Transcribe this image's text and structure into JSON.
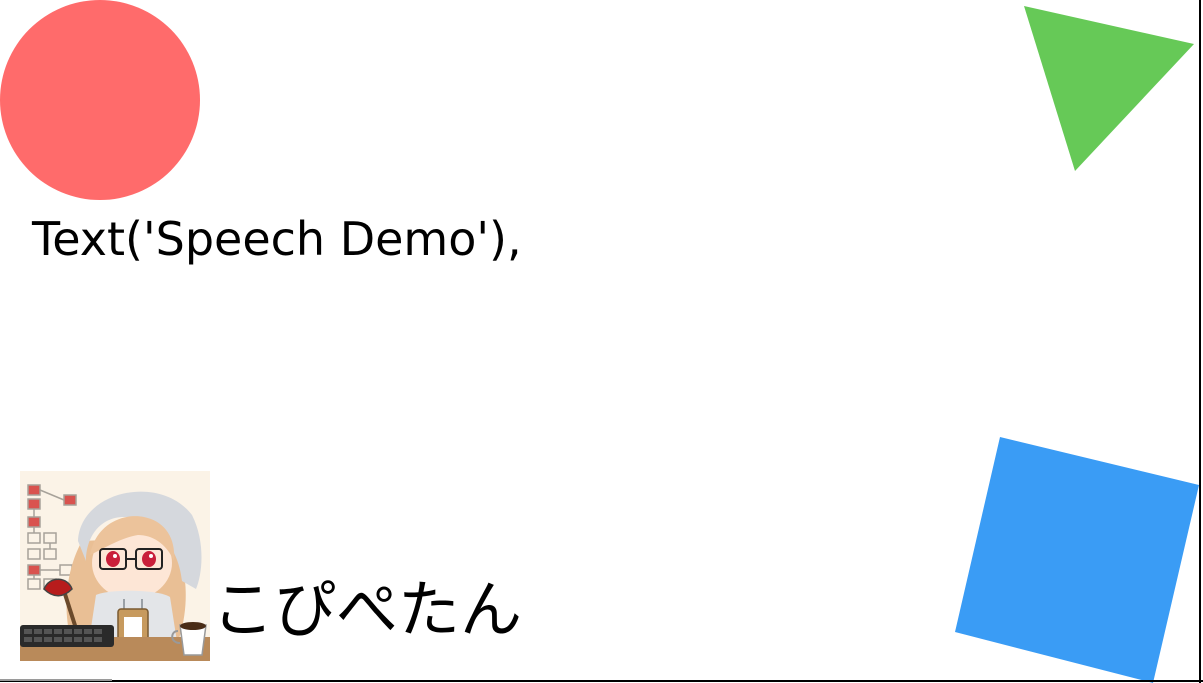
{
  "caption": {
    "text": "Text('Speech Demo'),"
  },
  "speaker": {
    "name": "こぴぺたん",
    "avatar_icon": "anime-character-avatar-icon"
  },
  "shapes": {
    "circle": {
      "icon": "circle-shape",
      "color": "#ff6b6b"
    },
    "triangle": {
      "icon": "triangle-shape",
      "color": "#66c957"
    },
    "square": {
      "icon": "square-shape",
      "color": "#3a9cf5"
    }
  }
}
